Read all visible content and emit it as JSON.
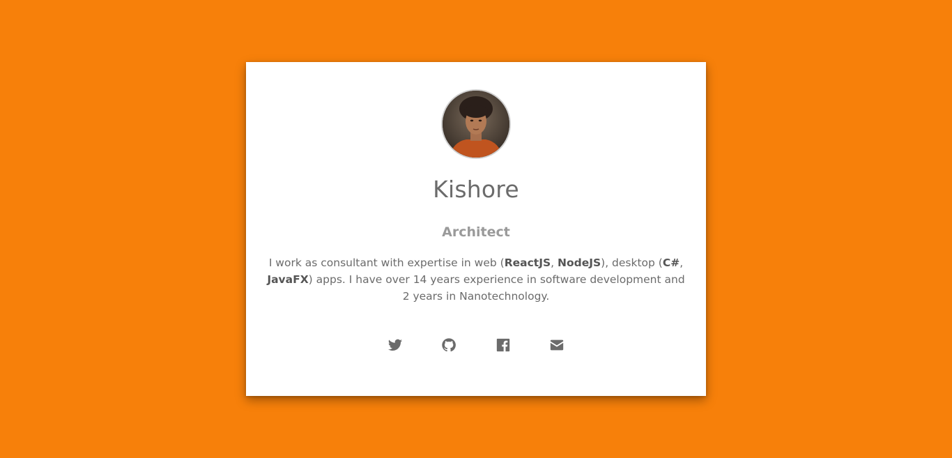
{
  "profile": {
    "name": "Kishore",
    "role": "Architect",
    "bio": {
      "t1": "I work as consultant with expertise in web (",
      "b1": "ReactJS",
      "t2": ", ",
      "b2": "NodeJS",
      "t3": "), desktop (",
      "b3": "C#",
      "t4": ", ",
      "b4": "JavaFX",
      "t5": ") apps. I have over 14 years experience in software development and 2 years in Nanotechnology."
    }
  },
  "social": [
    {
      "icon": "twitter-icon"
    },
    {
      "icon": "github-icon"
    },
    {
      "icon": "facebook-icon"
    },
    {
      "icon": "email-icon"
    }
  ],
  "colors": {
    "background": "#f7800a",
    "card": "#ffffff",
    "text": "#6b6b6b",
    "muted": "#9a9a9a"
  }
}
